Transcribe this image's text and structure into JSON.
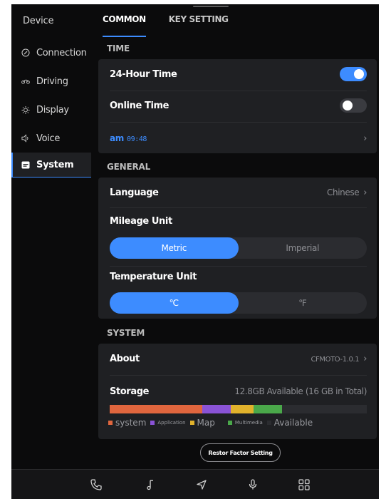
{
  "sidebar": {
    "title": "Device",
    "items": [
      {
        "label": "Connection",
        "icon": "connection-icon"
      },
      {
        "label": "Driving",
        "icon": "driving-icon"
      },
      {
        "label": "Display",
        "icon": "brightness-icon"
      },
      {
        "label": "Voice",
        "icon": "speaker-icon"
      },
      {
        "label": "System",
        "icon": "system-icon",
        "active": true
      }
    ]
  },
  "tabs": [
    {
      "label": "COMMON",
      "active": true
    },
    {
      "label": "KEY SETTING",
      "active": false
    }
  ],
  "time": {
    "section_label": "TIME",
    "hour24_label": "24-Hour Time",
    "hour24_on": true,
    "online_label": "Online Time",
    "online_on": false,
    "clock_ampm": "am",
    "clock_value": "09:48"
  },
  "general": {
    "section_label": "GENERAL",
    "language_label": "Language",
    "language_value": "Chinese",
    "mileage_label": "Mileage Unit",
    "mileage_options": [
      "Metric",
      "Imperial"
    ],
    "mileage_selected": "Metric",
    "temperature_label": "Temperature Unit",
    "temperature_options": [
      "℃",
      "℉"
    ],
    "temperature_selected": "℃"
  },
  "system": {
    "section_label": "SYSTEM",
    "about_label": "About",
    "about_value": "CFMOTO-1.0.1",
    "storage_label": "Storage",
    "storage_value": "12.8GB Available (16 GB in Total)",
    "storage_segments": [
      {
        "name": "system",
        "fraction": 0.36,
        "color": "#e0663e"
      },
      {
        "name": "Application",
        "fraction": 0.11,
        "color": "#8a53d6"
      },
      {
        "name": "Map",
        "fraction": 0.09,
        "color": "#e1b22c"
      },
      {
        "name": "Multimedia",
        "fraction": 0.11,
        "color": "#4aa84a"
      },
      {
        "name": "Available",
        "fraction": 0.33,
        "color": "#2b2c30"
      }
    ],
    "legend": {
      "system": "system",
      "application": "Application",
      "map": "Map",
      "multimedia": "Multimedia",
      "available": "Available"
    }
  },
  "reset_button": "Restor Factor Setting",
  "dock": [
    "phone-icon",
    "music-icon",
    "navigation-icon",
    "microphone-icon",
    "apps-grid-icon"
  ],
  "colors": {
    "accent": "#3d8cff",
    "background": "#0b0b0c",
    "card": "#1f2023"
  }
}
